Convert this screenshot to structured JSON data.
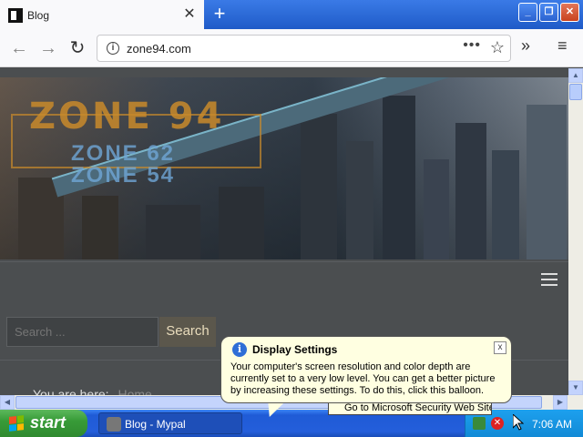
{
  "browser": {
    "tab_title": "Blog",
    "tab_close": "✕",
    "new_tab": "+",
    "url": "zone94.com",
    "more_dots": "•••",
    "star": "☆",
    "overflow": "»",
    "menu": "≡",
    "back": "←",
    "forward": "→",
    "reload": "↻",
    "window_buttons": {
      "minimize": "_",
      "restore": "❐",
      "close": "✕"
    }
  },
  "page": {
    "logo": "ZONE 94",
    "logo_sub1": "ZONE 62",
    "logo_sub2": "ZONE 54",
    "search_placeholder": "Search ...",
    "search_button": "Search",
    "breadcrumb_label": "You are here:",
    "breadcrumb_home": "Home"
  },
  "balloon": {
    "title": "Display Settings",
    "body": "Your computer's screen resolution and color depth are currently set to a very low level. You can get a better picture by increasing these settings. To do this, click this balloon.",
    "close": "x"
  },
  "tooltip": {
    "text": "Go to Microsoft Security Web Site"
  },
  "taskbar": {
    "start_label": "start",
    "task_label": "Blog - Mypal",
    "clock": "7:06 AM"
  },
  "icons": {
    "favicon": "favicon-icon",
    "info": "info-icon",
    "shield": "security-alert-icon"
  }
}
